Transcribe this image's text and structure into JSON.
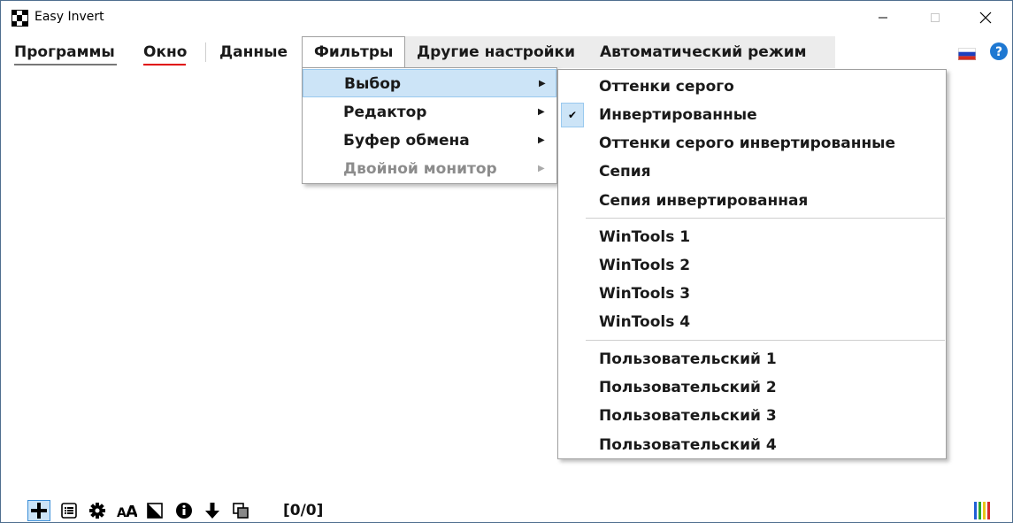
{
  "window": {
    "title": "Easy Invert"
  },
  "menubar": {
    "items": [
      {
        "label": "Программы",
        "underline_color": "#777777"
      },
      {
        "label": "Окно",
        "underline_color": "#e00000"
      },
      {
        "label": "Данные"
      },
      {
        "label": "Фильтры"
      },
      {
        "label": "Другие настройки"
      },
      {
        "label": "Автоматический режим"
      }
    ]
  },
  "filters_menu": {
    "items": [
      {
        "label": "Выбор",
        "has_submenu": true,
        "highlighted": true
      },
      {
        "label": "Редактор",
        "has_submenu": true
      },
      {
        "label": "Буфер обмена",
        "has_submenu": true
      },
      {
        "label": "Двойной монитор",
        "has_submenu": true,
        "disabled": true
      }
    ]
  },
  "select_submenu": {
    "items": [
      {
        "label": "Оттенки серого"
      },
      {
        "label": "Инвертированные",
        "checked": true
      },
      {
        "label": "Оттенки серого инвертированные"
      },
      {
        "label": "Сепия"
      },
      {
        "label": "Сепия инвертированная"
      },
      {
        "label": "WinTools 1"
      },
      {
        "label": "WinTools 2"
      },
      {
        "label": "WinTools 3"
      },
      {
        "label": "WinTools 4"
      },
      {
        "label": "Пользовательский 1"
      },
      {
        "label": "Пользовательский 2"
      },
      {
        "label": "Пользовательский 3"
      },
      {
        "label": "Пользовательский 4"
      }
    ]
  },
  "toolbar": {
    "icons": [
      "add-icon",
      "list-icon",
      "gear-icon",
      "font-size-icon",
      "contrast-icon",
      "info-icon",
      "download-icon",
      "copy-window-icon"
    ],
    "counter": "[0/0]"
  },
  "colors": {
    "highlight_bg": "#cce4f7",
    "highlight_border": "#99c9ef",
    "menubar_bg": "#ececec"
  }
}
